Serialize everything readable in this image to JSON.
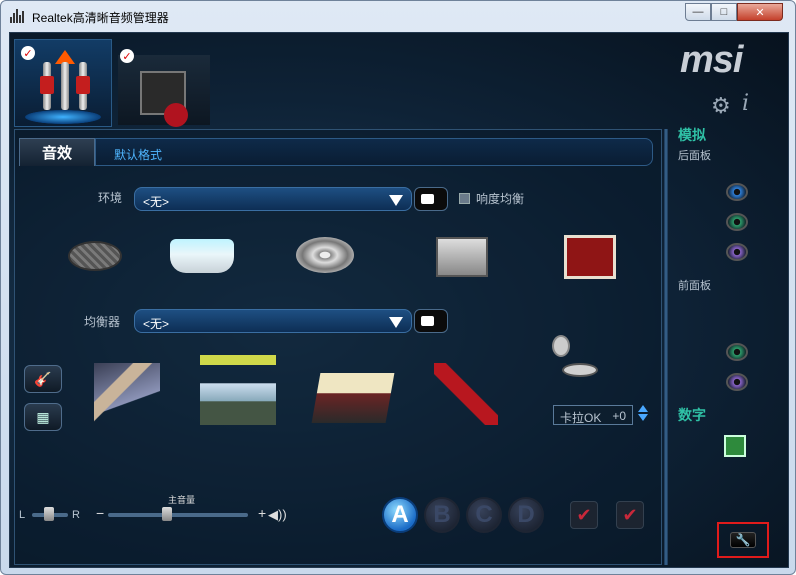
{
  "window": {
    "title": "Realtek高清晰音频管理器",
    "minimize_glyph": "—",
    "maximize_glyph": "□",
    "close_glyph": "✕"
  },
  "brand": {
    "logo_text": "msi"
  },
  "icons": {
    "settings": "gear-icon",
    "info": "info-icon",
    "tools": "wrench-icon"
  },
  "tabs": {
    "effects": "音效",
    "default_format": "默认格式"
  },
  "environment": {
    "label": "环境",
    "selected": "<无>",
    "loudness_label": "响度均衡",
    "presets": [
      "manhole",
      "bathtub",
      "disc",
      "room",
      "theater"
    ]
  },
  "equalizer": {
    "label": "均衡器",
    "selected": "<无>",
    "presets": [
      "keyboard",
      "concert",
      "table",
      "guitar",
      "karaoke"
    ]
  },
  "karaoke": {
    "label": "卡拉OK",
    "value": "+0"
  },
  "volume": {
    "balance_left": "L",
    "balance_right": "R",
    "main_label": "主音量",
    "minus": "−",
    "plus": "+",
    "speaker_glyph": "◀))"
  },
  "profiles": [
    "A",
    "B",
    "C",
    "D"
  ],
  "right_panel": {
    "analog": "模拟",
    "rear_panel": "后面板",
    "front_panel": "前面板",
    "digital": "数字"
  },
  "colors": {
    "accent_blue": "#4fb6ff",
    "section_teal": "#2fc1a6",
    "highlight_red": "#e01b1b",
    "rear_jack_1": "#2f7fd8",
    "rear_jack_2": "#2d9c6a",
    "rear_jack_3": "#8a64c8",
    "front_jack_1": "#2d9c6a",
    "front_jack_2": "#8a64c8"
  }
}
